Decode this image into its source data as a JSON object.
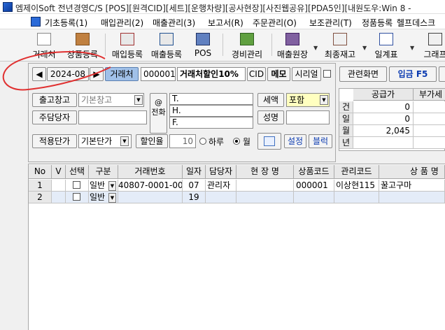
{
  "window": {
    "title": "엠제이Soft 전년경영C/S [POS][원격CID][세트][운행차량][공사현장][사진웹공유][PDA5인][내원도우:Win 8 -"
  },
  "menu": [
    "기초등록(1)",
    "매입관리(2)",
    "매출관리(3)",
    "보고서(R)",
    "주문관리(O)",
    "보조관리(T)",
    "정품등록",
    "헬프데스크"
  ],
  "toolbar": [
    "거래처",
    "상품등록",
    "매입등록",
    "매출등록",
    "POS",
    "경비관리",
    "매출원장",
    "최종재고",
    "일계표",
    "그래프"
  ],
  "nav": {
    "prev": "◀",
    "month": "2024-08",
    "next": "▶",
    "client_btn": "거래처",
    "client_code": "000001",
    "client_name": "거래처할인10%",
    "cid": "CID",
    "memo": "메모",
    "serial": "시리얼",
    "related": "관련화면",
    "deposit": "입금 F5"
  },
  "form": {
    "warehouse_btn": "출고창고",
    "warehouse_val": "기본창고",
    "manager_btn": "주담당자",
    "manager_val": "",
    "price_btn": "적용단가",
    "price_val": "기본단가",
    "discount_btn": "할인율",
    "discount_val": "10",
    "radio_daily": "하루",
    "radio_monthly": "월",
    "phone_label": "전화",
    "phone_t": "T.",
    "phone_h": "H.",
    "phone_f": "F.",
    "tax_label": "세액",
    "tax_val": "포함",
    "name_label": "성명",
    "settings_btn": "설정",
    "block_btn": "블럭"
  },
  "summary": {
    "col_supply": "공급가",
    "col_vat": "부가세",
    "rows": [
      {
        "label": "건",
        "supply": "0"
      },
      {
        "label": "일",
        "supply": "0"
      },
      {
        "label": "월",
        "supply": "2,045"
      },
      {
        "label": "년",
        "supply": ""
      }
    ]
  },
  "grid": {
    "headers": [
      "No",
      "V",
      "선택",
      "구분",
      "거래번호",
      "일자",
      "담당자",
      "현 장 명",
      "상품코드",
      "관리코드",
      "상 품 명"
    ],
    "rows": [
      {
        "no": "1",
        "type": "일반",
        "txn": "40807-0001-00",
        "day": "07",
        "staff": "관리자",
        "site": "",
        "prod": "000001",
        "mgmt": "이상현115",
        "pname": "꿀고구마"
      },
      {
        "no": "2",
        "type": "일반",
        "txn": "",
        "day": "19",
        "staff": "",
        "site": "",
        "prod": "",
        "mgmt": "",
        "pname": ""
      }
    ]
  },
  "colors": {
    "annotation": "#e03030",
    "highlight": "#ffffc0",
    "accent": "#0a3ab0"
  }
}
